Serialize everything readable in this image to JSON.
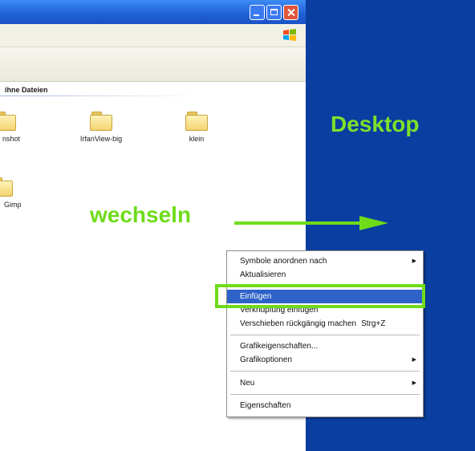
{
  "explorer": {
    "group_header": "ihne Dateien",
    "items": [
      {
        "label": "nshot"
      },
      {
        "label": "IrfanView-big"
      },
      {
        "label": "klein"
      },
      {
        "label": "Gimp"
      }
    ]
  },
  "desktop": {
    "label": "Desktop"
  },
  "annotation": {
    "switch_label": "wechseln",
    "accent_color": "#6fdc1a"
  },
  "context_menu": {
    "items": [
      {
        "label": "Symbole anordnen nach",
        "submenu": true
      },
      {
        "label": "Aktualisieren"
      },
      {
        "label": "Einfügen",
        "selected": true
      },
      {
        "label": "Verknüpfung einfügen"
      },
      {
        "label": "Verschieben rückgängig machen",
        "shortcut": "Strg+Z"
      },
      {
        "label": "Grafikeigenschaften..."
      },
      {
        "label": "Grafikoptionen",
        "submenu": true
      },
      {
        "label": "Neu",
        "submenu": true
      },
      {
        "label": "Eigenschaften"
      }
    ],
    "submenu_glyph": "▶"
  },
  "colors": {
    "desktop_bg": "#0a3ea0",
    "selection": "#2e62c9"
  }
}
